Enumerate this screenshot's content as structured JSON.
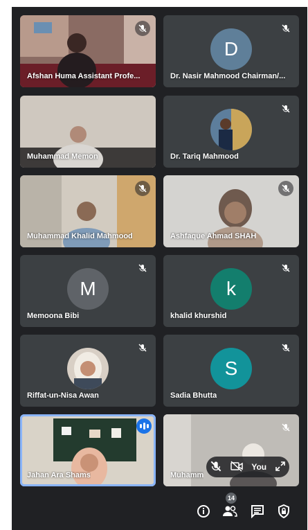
{
  "participants": [
    {
      "name": "Afshan Huma Assistant Profe...",
      "muted": true
    },
    {
      "name": "Dr. Nasir Mahmood Chairman/...",
      "muted": true,
      "initial": "D",
      "color": "#5f7f99"
    },
    {
      "name": "Muhammad Memon",
      "muted": false
    },
    {
      "name": "Dr. Tariq Mahmood",
      "muted": true
    },
    {
      "name": "Muhammad Khalid Mahmood",
      "muted": true
    },
    {
      "name": "Ashfaque Ahmad SHAH",
      "muted": true
    },
    {
      "name": "Memoona Bibi",
      "muted": true,
      "initial": "M",
      "color": "#5f6368"
    },
    {
      "name": "khalid khurshid",
      "muted": true,
      "initial": "k",
      "color": "#137e6d"
    },
    {
      "name": "Riffat-un-Nisa Awan",
      "muted": true
    },
    {
      "name": "Sadia Bhutta",
      "muted": true,
      "initial": "S",
      "color": "#12939a"
    },
    {
      "name": "Jahan Ara Shams",
      "speaking": true
    },
    {
      "name": "Muhamm",
      "muted": true
    }
  ],
  "self_view": {
    "label": "You"
  },
  "toolbar": {
    "people_count": "14"
  },
  "icons": [
    "mic-off-icon",
    "camera-off-icon",
    "expand-icon",
    "info-icon",
    "people-icon",
    "chat-icon",
    "lock-icon"
  ]
}
